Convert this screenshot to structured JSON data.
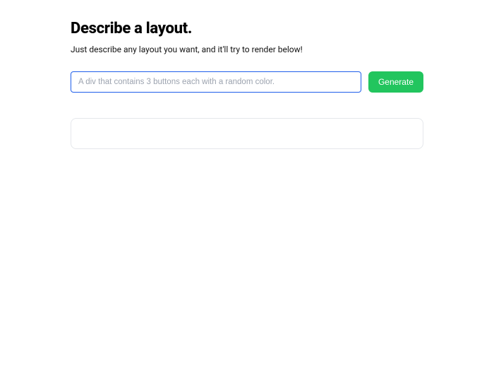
{
  "header": {
    "title": "Describe a layout.",
    "subtitle": "Just describe any layout you want, and it'll try to render below!"
  },
  "form": {
    "prompt_placeholder": "A div that contains 3 buttons each with a random color.",
    "prompt_value": "",
    "generate_label": "Generate"
  }
}
